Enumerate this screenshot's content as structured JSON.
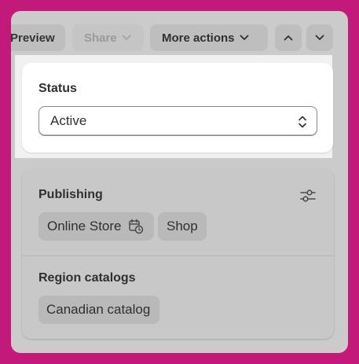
{
  "toolbar": {
    "preview_label": "Preview",
    "share_label": "Share",
    "more_actions_label": "More actions"
  },
  "status": {
    "title": "Status",
    "selected_value": "Active"
  },
  "publishing": {
    "title": "Publishing",
    "channels": [
      "Online Store",
      "Shop"
    ]
  },
  "region_catalogs": {
    "title": "Region catalogs",
    "items": [
      "Canadian catalog"
    ]
  },
  "colors": {
    "background": "#c2197a",
    "panel": "#cbcbcb",
    "card": "#ffffff",
    "chip": "#b9b9b9"
  },
  "icons": {
    "share_chevron": "chevron-down-icon",
    "more_chevron": "chevron-down-icon",
    "prev": "chevron-up-icon",
    "next": "chevron-down-icon",
    "select": "select-updown-icon",
    "publishing_settings": "sliders-icon",
    "schedule": "calendar-clock-icon"
  }
}
